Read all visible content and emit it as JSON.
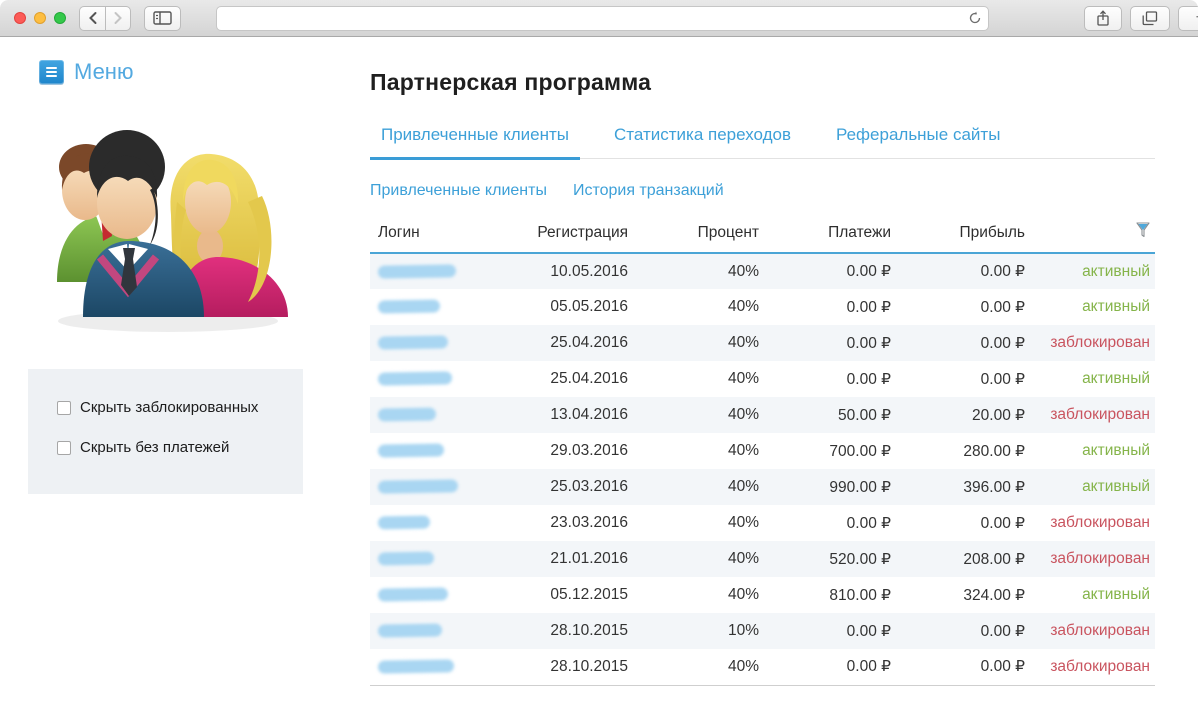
{
  "browser": {
    "window_controls": [
      "close",
      "minimize",
      "zoom"
    ],
    "url_value": "",
    "url_placeholder": "",
    "icons": [
      "back",
      "forward",
      "sidebar-toggle",
      "reload",
      "share",
      "tabs-overview",
      "new-tab"
    ]
  },
  "sidebar": {
    "menu_button": {
      "label": "Меню"
    },
    "illustration": "three-users-clipart",
    "filters": [
      {
        "label": "Скрыть заблокированных",
        "checked": false
      },
      {
        "label": "Скрыть без платежей",
        "checked": false
      }
    ]
  },
  "main": {
    "title": "Партнерская программа",
    "tabs": [
      {
        "label": "Привлеченные клиенты",
        "active": true
      },
      {
        "label": "Статистика переходов",
        "active": false
      },
      {
        "label": "Реферальные сайты",
        "active": false
      }
    ],
    "subtabs": [
      {
        "label": "Привлеченные клиенты",
        "active": true
      },
      {
        "label": "История транзакций",
        "active": false
      }
    ],
    "table": {
      "columns": [
        "Логин",
        "Регистрация",
        "Процент",
        "Платежи",
        "Прибыль"
      ],
      "filter_icon": "funnel-filter",
      "rows": [
        {
          "login_redacted": true,
          "blob_w": 78,
          "registration": "10.05.2016",
          "percent": "40%",
          "payments": "0.00 ₽",
          "profit": "0.00 ₽",
          "status": "активный",
          "status_type": "active"
        },
        {
          "login_redacted": true,
          "blob_w": 62,
          "registration": "05.05.2016",
          "percent": "40%",
          "payments": "0.00 ₽",
          "profit": "0.00 ₽",
          "status": "активный",
          "status_type": "active"
        },
        {
          "login_redacted": true,
          "blob_w": 70,
          "registration": "25.04.2016",
          "percent": "40%",
          "payments": "0.00 ₽",
          "profit": "0.00 ₽",
          "status": "заблокирован",
          "status_type": "blocked"
        },
        {
          "login_redacted": true,
          "blob_w": 74,
          "registration": "25.04.2016",
          "percent": "40%",
          "payments": "0.00 ₽",
          "profit": "0.00 ₽",
          "status": "активный",
          "status_type": "active"
        },
        {
          "login_redacted": true,
          "blob_w": 58,
          "registration": "13.04.2016",
          "percent": "40%",
          "payments": "50.00 ₽",
          "profit": "20.00 ₽",
          "status": "заблокирован",
          "status_type": "blocked"
        },
        {
          "login_redacted": true,
          "blob_w": 66,
          "registration": "29.03.2016",
          "percent": "40%",
          "payments": "700.00 ₽",
          "profit": "280.00 ₽",
          "status": "активный",
          "status_type": "active"
        },
        {
          "login_redacted": true,
          "blob_w": 80,
          "registration": "25.03.2016",
          "percent": "40%",
          "payments": "990.00 ₽",
          "profit": "396.00 ₽",
          "status": "активный",
          "status_type": "active"
        },
        {
          "login_redacted": true,
          "blob_w": 52,
          "registration": "23.03.2016",
          "percent": "40%",
          "payments": "0.00 ₽",
          "profit": "0.00 ₽",
          "status": "заблокирован",
          "status_type": "blocked"
        },
        {
          "login_redacted": true,
          "blob_w": 56,
          "registration": "21.01.2016",
          "percent": "40%",
          "payments": "520.00 ₽",
          "profit": "208.00 ₽",
          "status": "заблокирован",
          "status_type": "blocked"
        },
        {
          "login_redacted": true,
          "blob_w": 70,
          "registration": "05.12.2015",
          "percent": "40%",
          "payments": "810.00 ₽",
          "profit": "324.00 ₽",
          "status": "активный",
          "status_type": "active"
        },
        {
          "login_redacted": true,
          "blob_w": 64,
          "registration": "28.10.2015",
          "percent": "10%",
          "payments": "0.00 ₽",
          "profit": "0.00 ₽",
          "status": "заблокирован",
          "status_type": "blocked"
        },
        {
          "login_redacted": true,
          "blob_w": 76,
          "registration": "28.10.2015",
          "percent": "40%",
          "payments": "0.00 ₽",
          "profit": "0.00 ₽",
          "status": "заблокирован",
          "status_type": "blocked"
        }
      ]
    }
  },
  "colors": {
    "accent_blue": "#3da0d8",
    "status_active_green": "#85b44a",
    "status_blocked_red": "#c9545f",
    "row_alt_bg": "#f3f6f9",
    "header_underline": "#4aa5d6"
  }
}
